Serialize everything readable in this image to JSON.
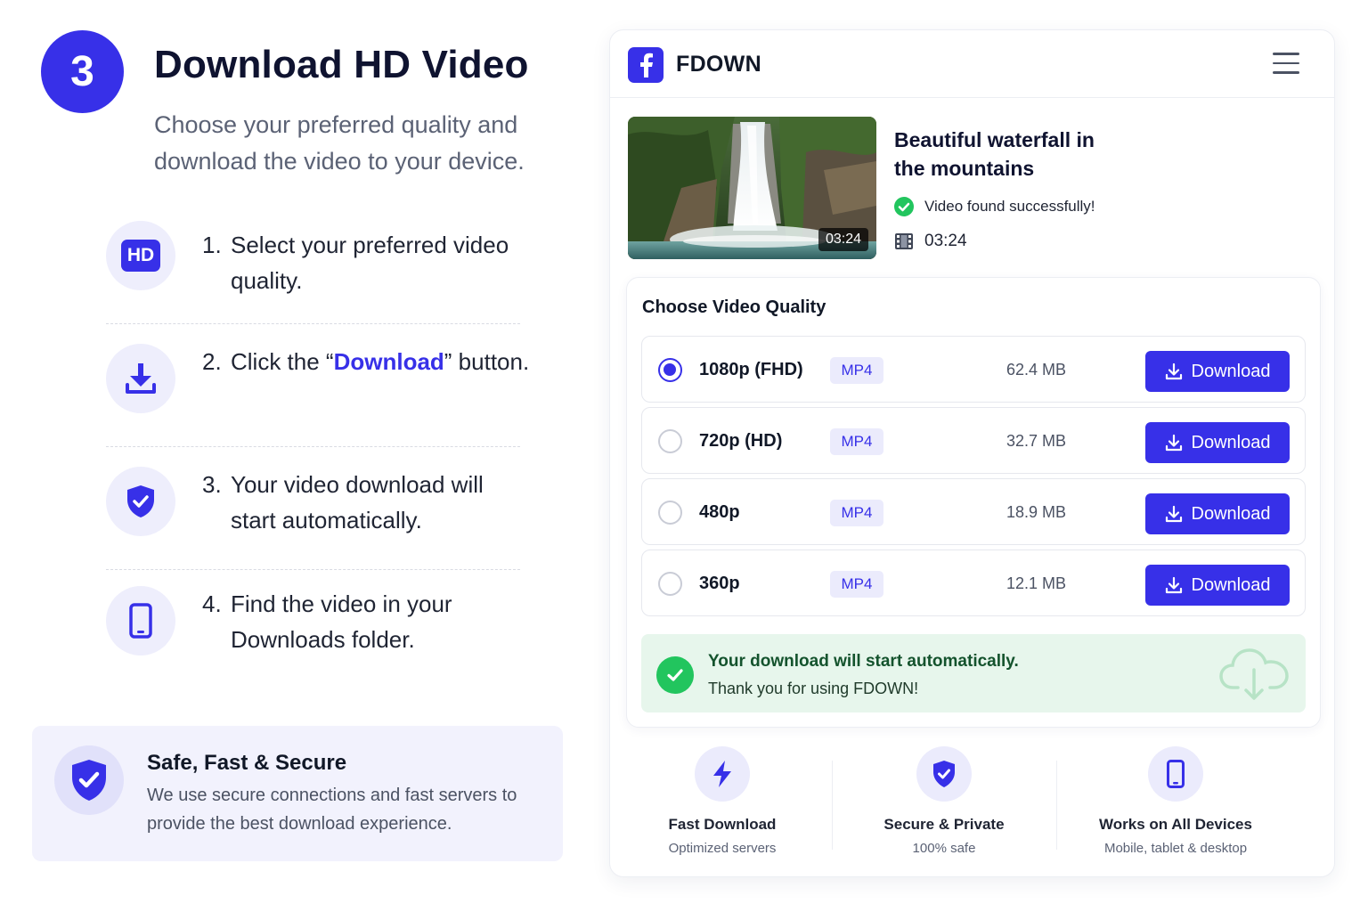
{
  "step": {
    "number": "3",
    "title": "Download HD Video",
    "subtitle": "Choose your preferred quality and download the video to your device."
  },
  "instructions": [
    {
      "num": "1.",
      "text": "Select your preferred video quality.",
      "icon": "hd-icon",
      "chip": "HD"
    },
    {
      "num": "2.",
      "text_before": "Click the “",
      "highlight": "Download",
      "text_after": "” button.",
      "icon": "download-icon"
    },
    {
      "num": "3.",
      "text": "Your video download will start automatically.",
      "icon": "shield-check-icon"
    },
    {
      "num": "4.",
      "text": "Find the video in your Downloads folder.",
      "icon": "phone-icon"
    }
  ],
  "secure": {
    "title": "Safe, Fast & Secure",
    "text": "We use secure connections and fast servers to provide the best download experience.",
    "icon": "shield-check-icon"
  },
  "app": {
    "name": "FDOWN",
    "logo_icon": "facebook-icon",
    "menu_icon": "hamburger-menu-icon"
  },
  "video": {
    "title": "Beautiful waterfall in the mountains",
    "status": "Video found successfully!",
    "duration": "03:24",
    "thumb_duration": "03:24"
  },
  "quality": {
    "heading": "Choose Video Quality",
    "options": [
      {
        "label": "1080p (FHD)",
        "format": "MP4",
        "size": "62.4 MB",
        "button": "Download",
        "selected": true
      },
      {
        "label": "720p (HD)",
        "format": "MP4",
        "size": "32.7 MB",
        "button": "Download",
        "selected": false
      },
      {
        "label": "480p",
        "format": "MP4",
        "size": "18.9 MB",
        "button": "Download",
        "selected": false
      },
      {
        "label": "360p",
        "format": "MP4",
        "size": "12.1 MB",
        "button": "Download",
        "selected": false
      }
    ]
  },
  "notice": {
    "title": "Your download will start automatically.",
    "text": "Thank you for using FDOWN!",
    "icon": "cloud-download-icon"
  },
  "features": [
    {
      "title": "Fast Download",
      "sub": "Optimized servers",
      "icon": "lightning-icon"
    },
    {
      "title": "Secure & Private",
      "sub": "100% safe",
      "icon": "shield-check-icon"
    },
    {
      "title": "Works on All Devices",
      "sub": "Mobile, tablet & desktop",
      "icon": "phone-icon"
    }
  ],
  "colors": {
    "accent": "#3730e8",
    "success": "#22c55e",
    "success_bg": "#e7f6ec",
    "soft_accent_bg": "#ebebfc"
  }
}
